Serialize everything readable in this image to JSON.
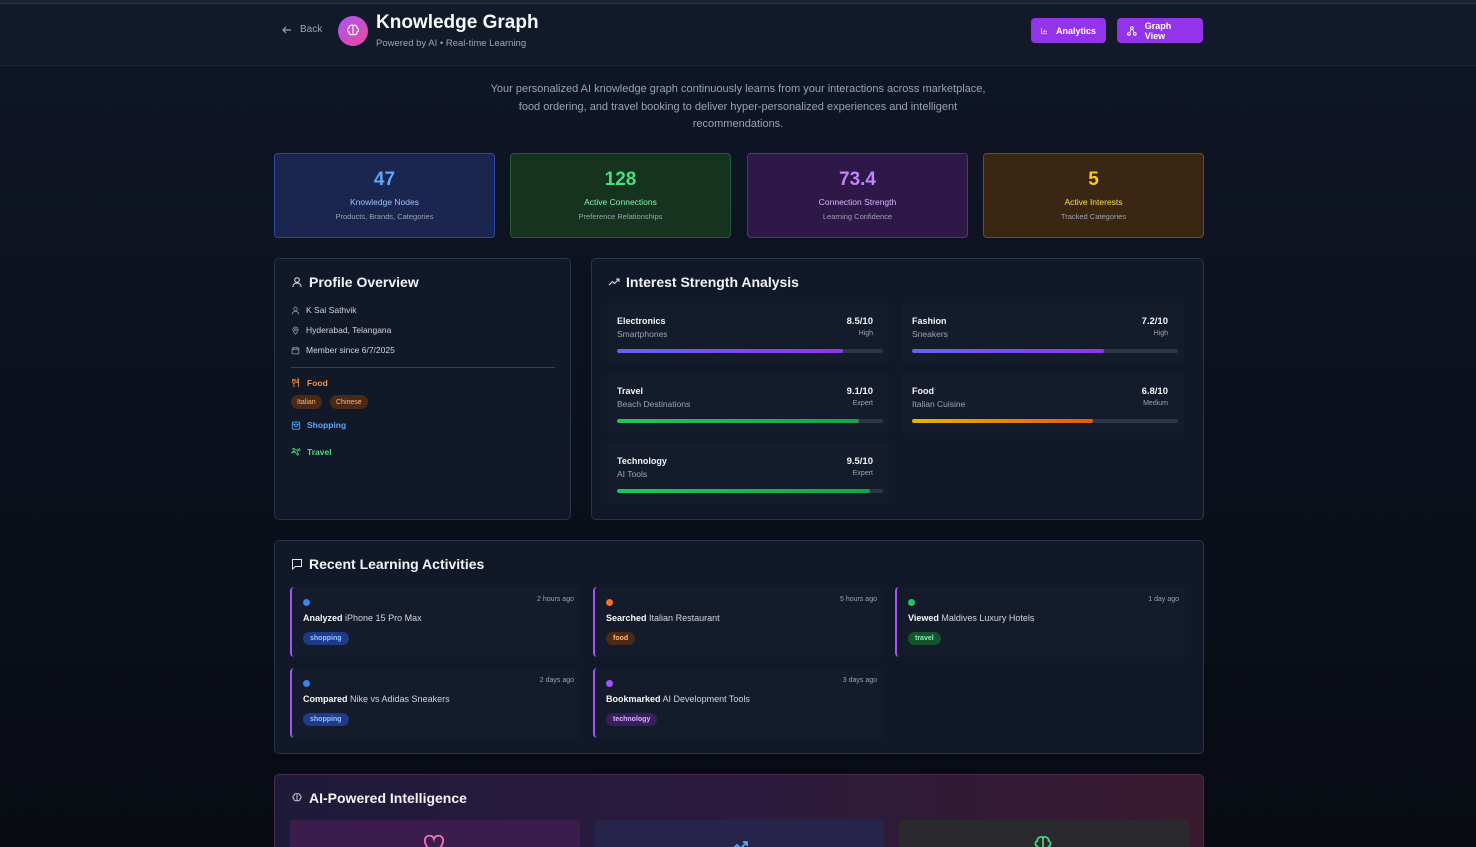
{
  "header": {
    "back_label": "Back",
    "title": "Knowledge Graph",
    "subtitle": "Powered by AI • Real-time Learning",
    "analytics_label": "Analytics",
    "graph_view_label": "Graph View"
  },
  "description": "Your personalized AI knowledge graph continuously learns from your interactions across marketplace, food ordering, and travel booking to deliver hyper-personalized experiences and intelligent recommendations.",
  "stats": [
    {
      "value": "47",
      "label": "Knowledge Nodes",
      "sub": "Products, Brands, Categories"
    },
    {
      "value": "128",
      "label": "Active Connections",
      "sub": "Preference Relationships"
    },
    {
      "value": "73.4",
      "label": "Connection Strength",
      "sub": "Learning Confidence"
    },
    {
      "value": "5",
      "label": "Active Interests",
      "sub": "Tracked Categories"
    }
  ],
  "profile": {
    "title": "Profile Overview",
    "name": "K Sai Sathvik",
    "location": "Hyderabad, Telangana",
    "member_since": "Member since 6/7/2025",
    "categories": {
      "food": {
        "label": "Food",
        "tags": [
          "Italian",
          "Chinese"
        ],
        "color": "#fb923c"
      },
      "shopping": {
        "label": "Shopping",
        "color": "#60a5fa"
      },
      "travel": {
        "label": "Travel",
        "color": "#4ade80"
      }
    }
  },
  "interest": {
    "title": "Interest Strength Analysis",
    "items": [
      {
        "name": "Electronics",
        "sub": "Smartphones",
        "score": "8.5/10",
        "level": "High",
        "fraction": 0.85,
        "color": "#6366f1",
        "color2": "#9333ea"
      },
      {
        "name": "Fashion",
        "sub": "Sneakers",
        "score": "7.2/10",
        "level": "High",
        "fraction": 0.72,
        "color": "#6366f1",
        "color2": "#9333ea"
      },
      {
        "name": "Travel",
        "sub": "Beach Destinations",
        "score": "9.1/10",
        "level": "Expert",
        "fraction": 0.91,
        "color": "#22c55e",
        "color2": "#16a34a"
      },
      {
        "name": "Food",
        "sub": "Italian Cuisine",
        "score": "6.8/10",
        "level": "Medium",
        "fraction": 0.68,
        "color": "#eab308",
        "color2": "#ea580c"
      },
      {
        "name": "Technology",
        "sub": "AI Tools",
        "score": "9.5/10",
        "level": "Expert",
        "fraction": 0.95,
        "color": "#22c55e",
        "color2": "#16a34a"
      }
    ]
  },
  "recent": {
    "title": "Recent Learning Activities",
    "items": [
      {
        "verb": "Analyzed",
        "object": "iPhone 15 Pro Max",
        "time": "2 hours ago",
        "tag": "shopping",
        "dot": "#3b82f6",
        "tag_bg": "#1e3a8a",
        "tag_fg": "#93c5fd"
      },
      {
        "verb": "Searched",
        "object": "Italian Restaurant",
        "time": "5 hours ago",
        "tag": "food",
        "dot": "#f97316",
        "tag_bg": "#4a2a16",
        "tag_fg": "#fdba74"
      },
      {
        "verb": "Viewed",
        "object": "Maldives Luxury Hotels",
        "time": "1 day ago",
        "tag": "travel",
        "dot": "#22c55e",
        "tag_bg": "#14532d",
        "tag_fg": "#86efac"
      },
      {
        "verb": "Compared",
        "object": "Nike vs Adidas Sneakers",
        "time": "2 days ago",
        "tag": "shopping",
        "dot": "#3b82f6",
        "tag_bg": "#1e3a8a",
        "tag_fg": "#93c5fd"
      },
      {
        "verb": "Bookmarked",
        "object": "AI Development Tools",
        "time": "3 days ago",
        "tag": "technology",
        "dot": "#a855f7",
        "tag_bg": "#3b1d5e",
        "tag_fg": "#d8b4fe"
      }
    ]
  },
  "ai": {
    "title": "AI-Powered Intelligence"
  }
}
